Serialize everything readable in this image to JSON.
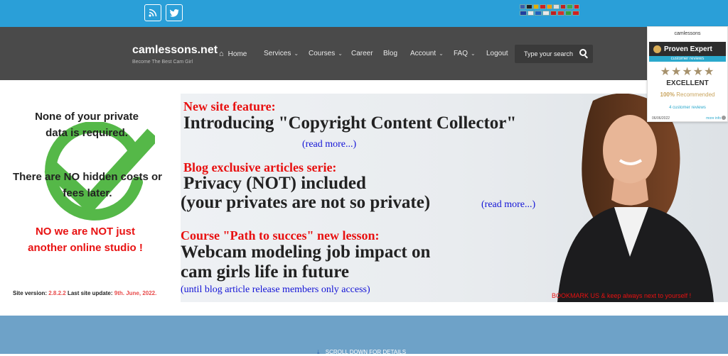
{
  "topbar": {
    "rss_icon": "rss-icon",
    "twitter_icon": "twitter-icon",
    "flags_row1": [
      "#3c5aa8",
      "#222222",
      "#e0b000",
      "#d02020",
      "#f2a000",
      "#dddddd",
      "#c02020",
      "#3aa84a",
      "#d02020"
    ],
    "flags_row2": [
      "#2040a0",
      "#e8e8e8",
      "#2060c0",
      "#e8e8e8",
      "#c02020",
      "#d03030",
      "#30a040",
      "#d02020"
    ]
  },
  "header": {
    "brand": "camlessons.net",
    "tagline": "Become The Best Cam Girl",
    "nav": {
      "home": "Home",
      "services": "Services",
      "courses": "Courses",
      "career": "Career",
      "blog": "Blog",
      "account": "Account",
      "faq": "FAQ",
      "logout": "Logout"
    },
    "search_placeholder": "Type your search"
  },
  "left": {
    "line1": "None of your private",
    "line2": "data is required.",
    "line3": "There are NO hidden costs or",
    "line4": "fees later.",
    "line5": "NO we are NOT just",
    "line6": "another online studio !",
    "version_label": "Site version:",
    "version_value": "2.8.2.2",
    "update_label": "Last site update:",
    "update_value": "9th. June, 2022."
  },
  "banner": {
    "feature_label": "New site feature:",
    "feature_title": "Introducing \"Copyright Content Collector\"",
    "feature_link": "(read more...)",
    "blog_label": "Blog exclusive articles serie:",
    "blog_title1": "Privacy (NOT) included",
    "blog_title2": "(your privates are not so private)",
    "blog_link": "(read more...)",
    "course_label": "Course \"Path to succes\" new lesson:",
    "course_title1": "Webcam modeling  job impact on",
    "course_title2": "cam girls life in future",
    "course_note": "(until blog article release members only access)",
    "bookmark": "BOOKMARK US & keep always next to yourself !"
  },
  "proven_expert": {
    "site": "camlessons",
    "brand": "Proven Expert",
    "subtitle": "customer reviews",
    "stars": "★★★★★",
    "rating": "EXCELLENT",
    "recommend_pct": "100%",
    "recommend_text": "Recommended",
    "review_count": "4 customer reviews",
    "date": "06/06/2022",
    "more": "more info"
  },
  "bottom": {
    "scroll_text": "SCROLL DOWN FOR DETAILS"
  }
}
